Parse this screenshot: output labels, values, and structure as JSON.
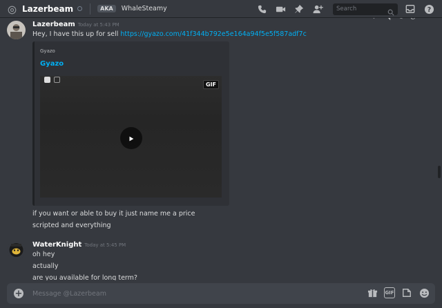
{
  "header": {
    "dm_name": "Lazerbeam",
    "aka_label": "AKA",
    "aka_name": "WhaleSteamy",
    "search_placeholder": "Search"
  },
  "messages": [
    {
      "author": "Lazerbeam",
      "timestamp": "Today at 5:43 PM",
      "lines": [
        {
          "text": "Hey, I have this up for sell ",
          "link": "https://gyazo.com/41f344b792e5e164a94f5e5f587adf7c"
        }
      ],
      "embed": {
        "provider": "Gyazo",
        "title": "Gyazo",
        "badge": "GIF"
      },
      "after_lines": [
        "if you want or able to buy it just name me a price",
        "scripted and everything"
      ]
    },
    {
      "author": "WaterKnight",
      "timestamp": "Today at 5:45 PM",
      "lines": [
        "oh hey",
        "actually",
        "are you available for long term?"
      ]
    }
  ],
  "composer": {
    "placeholder": "Message @Lazerbeam",
    "gif_label": "GIF"
  },
  "icons": [
    "at-icon",
    "call-icon",
    "video-icon",
    "pin-icon",
    "add-friend-icon",
    "search-icon",
    "inbox-icon",
    "help-icon",
    "play-icon",
    "gift-icon",
    "gif-icon",
    "upload-icon",
    "emoji-icon"
  ]
}
